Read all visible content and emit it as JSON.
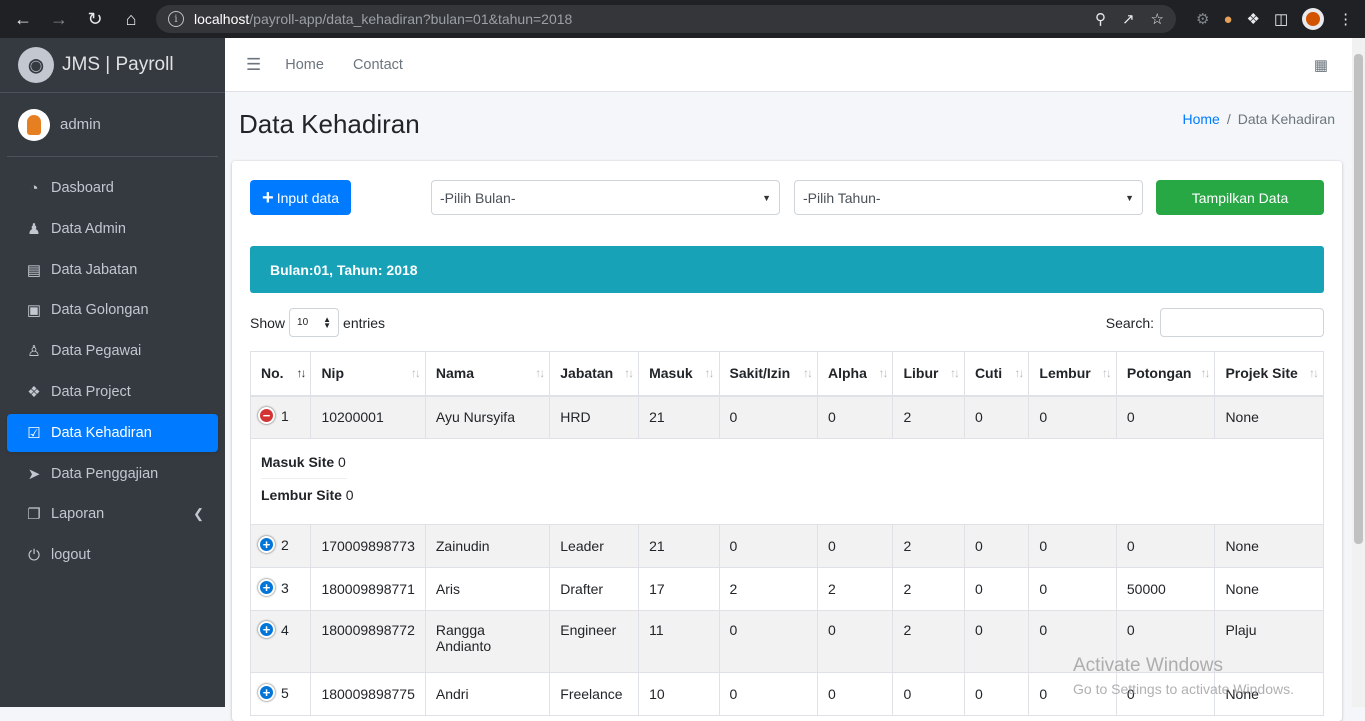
{
  "browser": {
    "url_host": "localhost",
    "url_path": "/payroll-app/data_kehadiran?bulan=01&tahun=2018"
  },
  "sidebar": {
    "brand": "JMS | Payroll",
    "user": "admin",
    "items": [
      {
        "label": "Dasboard",
        "icon": "tachometer-icon"
      },
      {
        "label": "Data Admin",
        "icon": "user-icon"
      },
      {
        "label": "Data Jabatan",
        "icon": "briefcase-icon"
      },
      {
        "label": "Data Golongan",
        "icon": "book-icon"
      },
      {
        "label": "Data Pegawai",
        "icon": "users-icon"
      },
      {
        "label": "Data Project",
        "icon": "cubes-icon"
      },
      {
        "label": "Data Kehadiran",
        "icon": "calendar-check-icon",
        "active": true
      },
      {
        "label": "Data Penggajian",
        "icon": "paper-plane-icon"
      },
      {
        "label": "Laporan",
        "icon": "copy-icon"
      },
      {
        "label": "logout",
        "icon": "power-icon"
      }
    ]
  },
  "topnav": {
    "home": "Home",
    "contact": "Contact"
  },
  "page": {
    "title": "Data Kehadiran",
    "breadcrumb_home": "Home",
    "breadcrumb_sep": "/",
    "breadcrumb_current": "Data Kehadiran"
  },
  "toolbar": {
    "input_label": "Input data",
    "bulan_placeholder": "-Pilih Bulan-",
    "tahun_placeholder": "-Pilih Tahun-",
    "show_label": "Tampilkan Data"
  },
  "info_bar": "Bulan:01, Tahun: 2018",
  "datatable": {
    "show_label": "Show",
    "length_value": "10",
    "entries_label": "entries",
    "search_label": "Search:"
  },
  "table": {
    "headers": [
      "No.",
      "Nip",
      "Nama",
      "Jabatan",
      "Masuk",
      "Sakit/Izin",
      "Alpha",
      "Libur",
      "Cuti",
      "Lembur",
      "Potongan",
      "Projek Site"
    ],
    "rows": [
      {
        "no": "1",
        "nip": "10200001",
        "nama": "Ayu Nursyifa",
        "jabatan": "HRD",
        "masuk": "21",
        "sakit": "0",
        "alpha": "0",
        "libur": "2",
        "cuti": "0",
        "lembur": "0",
        "potongan": "0",
        "projek": "None",
        "expanded": true
      },
      {
        "no": "2",
        "nip": "170009898773",
        "nama": "Zainudin",
        "jabatan": "Leader",
        "masuk": "21",
        "sakit": "0",
        "alpha": "0",
        "libur": "2",
        "cuti": "0",
        "lembur": "0",
        "potongan": "0",
        "projek": "None"
      },
      {
        "no": "3",
        "nip": "180009898771",
        "nama": "Aris",
        "jabatan": "Drafter",
        "masuk": "17",
        "sakit": "2",
        "alpha": "2",
        "libur": "2",
        "cuti": "0",
        "lembur": "0",
        "potongan": "50000",
        "projek": "None"
      },
      {
        "no": "4",
        "nip": "180009898772",
        "nama": "Rangga Andianto",
        "jabatan": "Engineer",
        "masuk": "11",
        "sakit": "0",
        "alpha": "0",
        "libur": "2",
        "cuti": "0",
        "lembur": "0",
        "potongan": "0",
        "projek": "Plaju"
      },
      {
        "no": "5",
        "nip": "180009898775",
        "nama": "Andri",
        "jabatan": "Freelance",
        "masuk": "10",
        "sakit": "0",
        "alpha": "0",
        "libur": "0",
        "cuti": "0",
        "lembur": "0",
        "potongan": "0",
        "projek": "None"
      }
    ],
    "child": {
      "masuk_site_label": "Masuk Site",
      "masuk_site_value": "0",
      "lembur_site_label": "Lembur Site",
      "lembur_site_value": "0"
    }
  },
  "watermark": {
    "line1": "Activate Windows",
    "line2": "Go to Settings to activate Windows."
  },
  "colors": {
    "primary": "#007bff",
    "success": "#28a745",
    "info": "#17a2b8",
    "sidebar": "#343a40"
  }
}
